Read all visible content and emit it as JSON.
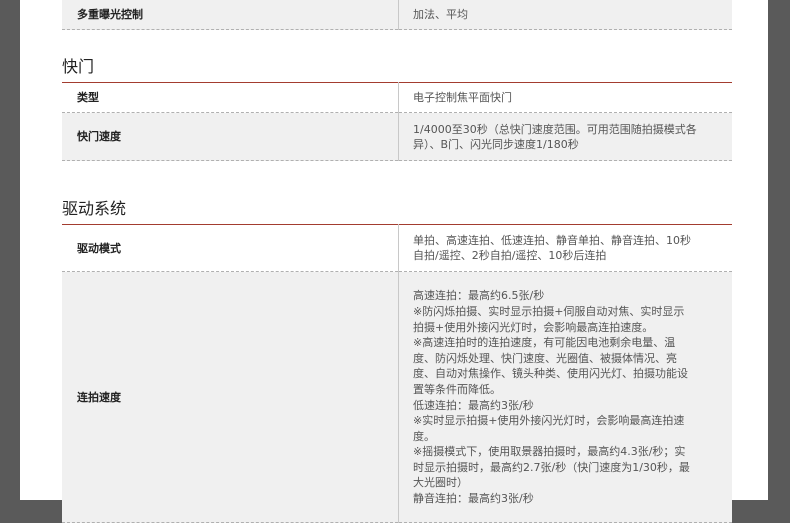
{
  "top_row": {
    "label": "多重曝光控制",
    "value": "加法、平均"
  },
  "shutter": {
    "title": "快门",
    "rows": [
      {
        "label": "类型",
        "value": "电子控制焦平面快门"
      },
      {
        "label": "快门速度",
        "value_lines": [
          "1/4000至30秒（总快门速度范围。可用范围随拍摄模式各",
          "异）、B门、闪光同步速度1/180秒"
        ]
      }
    ]
  },
  "drive": {
    "title": "驱动系统",
    "rows": [
      {
        "label": "驱动模式",
        "value_lines": [
          "单拍、高速连拍、低速连拍、静音单拍、静音连拍、10秒",
          "自拍/遥控、2秒自拍/遥控、10秒后连拍"
        ]
      },
      {
        "label": "连拍速度",
        "value_lines": [
          "高速连拍：最高约6.5张/秒",
          "※防闪烁拍摄、实时显示拍摄+伺服自动对焦、实时显示",
          "拍摄+使用外接闪光灯时，会影响最高连拍速度。",
          "※高速连拍时的连拍速度，有可能因电池剩余电量、温",
          "度、防闪烁处理、快门速度、光圈值、被摄体情况、亮",
          "度、自动对焦操作、镜头种类、使用闪光灯、拍摄功能设",
          "置等条件而降低。",
          "低速连拍：最高约3张/秒",
          "※实时显示拍摄+使用外接闪光灯时，会影响最高连拍速",
          "度。",
          "※摇摄模式下，使用取景器拍摄时，最高约4.3张/秒；实",
          "时显示拍摄时，最高约2.7张/秒（快门速度为1/30秒，最",
          "大光圈时）",
          "静音连拍：最高约3张/秒"
        ]
      }
    ]
  }
}
